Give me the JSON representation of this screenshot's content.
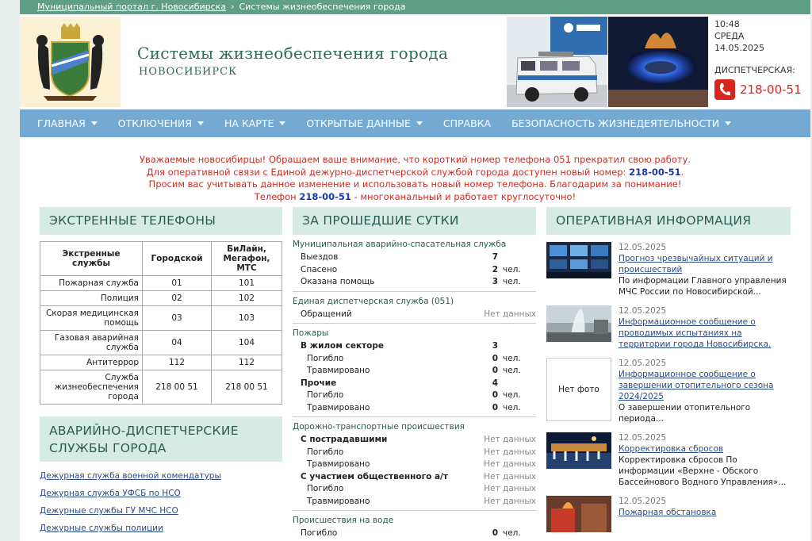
{
  "breadcrumb": {
    "home": "Муниципальный портал г. Новосибирска",
    "sep": "›",
    "current": "Системы жизнеобеспечения города"
  },
  "header": {
    "title": "Системы жизнеобеспечения города",
    "subtitle": "НОВОСИБИРСК"
  },
  "clock": {
    "time": "10:48",
    "weekday": "СРЕДА",
    "date": "14.05.2025",
    "dispatch_label": "ДИСПЕТЧЕРСКАЯ:",
    "dispatch_phone": "218-00-51"
  },
  "nav": [
    {
      "label": "ГЛАВНАЯ",
      "dropdown": true
    },
    {
      "label": "ОТКЛЮЧЕНИЯ",
      "dropdown": true
    },
    {
      "label": "НА КАРТЕ",
      "dropdown": true
    },
    {
      "label": "ОТКРЫТЫЕ ДАННЫЕ",
      "dropdown": true
    },
    {
      "label": "СПРАВКА",
      "dropdown": false
    },
    {
      "label": "БЕЗОПАСНОСТЬ ЖИЗНЕДЕЯТЕЛЬНОСТИ",
      "dropdown": true
    }
  ],
  "notice": {
    "line1": "Уважаемые новосибирцы! Обращаем ваше внимание, что короткий номер телефона 051 прекратил свою работу.",
    "line2_pre": "Для оперативной связи с Единой дежурно-диспетчерской службой города доступен новый номер: ",
    "line2_num": "218-00-51",
    "line2_post": ".",
    "line3": "Просим вас учитывать данное изменение и использовать новый номер телефона. Благодарим за понимание!",
    "line4_pre": "Телефон ",
    "line4_num": "218-00-51",
    "line4_post": " - многоканальный и работает круглосуточно!"
  },
  "emergency": {
    "title": "ЭКСТРЕННЫЕ ТЕЛЕФОНЫ",
    "headers": [
      "Экстренные службы",
      "Городской",
      "БиЛайн, Мегафон, МТС"
    ],
    "rows": [
      [
        "Пожарная служба",
        "01",
        "101"
      ],
      [
        "Полиция",
        "02",
        "102"
      ],
      [
        "Скорая медицинская помощь",
        "03",
        "103"
      ],
      [
        "Газовая аварийная служба",
        "04",
        "104"
      ],
      [
        "Антитеррор",
        "112",
        "112"
      ],
      [
        "Служба жизнеобеспечения города",
        "218 00 51",
        "218 00 51"
      ]
    ]
  },
  "dispatch": {
    "title": "АВАРИЙНО-ДИСПЕТЧЕРСКИЕ СЛУЖБЫ ГОРОДА",
    "links": [
      "Дежурная служба военной комендатуры",
      "Дежурная служба УФСБ по НСО",
      "Дежурные службы ГУ МЧС НСО",
      "Дежурные службы полиции"
    ]
  },
  "daily": {
    "title": "ЗА ПРОШЕДШИЕ СУТКИ",
    "sections": [
      {
        "title": "Муниципальная аварийно-спасательная служба",
        "rows": [
          {
            "label": "Выездов",
            "value": "7",
            "unit": ""
          },
          {
            "label": "Спасено",
            "value": "2",
            "unit": "чел."
          },
          {
            "label": "Оказана помощь",
            "value": "3",
            "unit": "чел."
          }
        ]
      },
      {
        "title": "Единая диспетчерская служба (051)",
        "rows": [
          {
            "label": "Обращений",
            "nodata": "Нет данных"
          }
        ]
      },
      {
        "title": "Пожары",
        "rows": [
          {
            "label": "В жилом секторе",
            "value": "3",
            "unit": "",
            "bold": true
          },
          {
            "label": "Погибло",
            "value": "0",
            "unit": "чел.",
            "sub": true
          },
          {
            "label": "Травмировано",
            "value": "0",
            "unit": "чел.",
            "sub": true
          },
          {
            "label": "Прочие",
            "value": "4",
            "unit": "",
            "bold": true
          },
          {
            "label": "Погибло",
            "value": "0",
            "unit": "чел.",
            "sub": true
          },
          {
            "label": "Травмировано",
            "value": "0",
            "unit": "чел.",
            "sub": true
          }
        ]
      },
      {
        "title": "Дорожно-транспортные происшествия",
        "rows": [
          {
            "label": "С пострадавшими",
            "nodata": "Нет данных",
            "bold": true
          },
          {
            "label": "Погибло",
            "nodata": "Нет данных",
            "sub": true
          },
          {
            "label": "Травмировано",
            "nodata": "Нет данных",
            "sub": true
          },
          {
            "label": "С участием общественного а/т",
            "nodata": "Нет данных",
            "bold": true
          },
          {
            "label": "Погибло",
            "nodata": "Нет данных",
            "sub": true
          },
          {
            "label": "Травмировано",
            "nodata": "Нет данных",
            "sub": true
          }
        ]
      },
      {
        "title": "Происшествия на воде",
        "rows": [
          {
            "label": "Погибло",
            "value": "0",
            "unit": "чел."
          }
        ]
      }
    ]
  },
  "news": {
    "title": "ОПЕРАТИВНАЯ ИНФОРМАЦИЯ",
    "no_photo": "Нет фото",
    "items": [
      {
        "date": "12.05.2025",
        "title": "Прогноз чрезвычайных ситуаций и происшествий",
        "text": "По информации Главного управления МЧС России по Новосибирской...",
        "thumb": "control-room"
      },
      {
        "date": "12.05.2025",
        "title": "Информационное сообщение о проводимых испытаниях на территории города Новосибирска.",
        "text": "",
        "thumb": "water-jet"
      },
      {
        "date": "12.05.2025",
        "title": "Информационное сообщение о завершении отопительного сезона 2024/2025",
        "text": "О завершении отопительного периода...",
        "thumb": "none"
      },
      {
        "date": "12.05.2025",
        "title": "Корректировка сбросов",
        "text": "Корректировка сбросов По информации «Верхне - Обского Бассейнового Водного Управления»...",
        "thumb": "dam"
      },
      {
        "date": "12.05.2025",
        "title": "Пожарная обстановка",
        "text": "",
        "thumb": "fire"
      }
    ]
  },
  "colors": {
    "accent": "#5f9f86",
    "nav": "#74a9d1",
    "alert": "#d42a20",
    "link": "#2a4a8a"
  }
}
